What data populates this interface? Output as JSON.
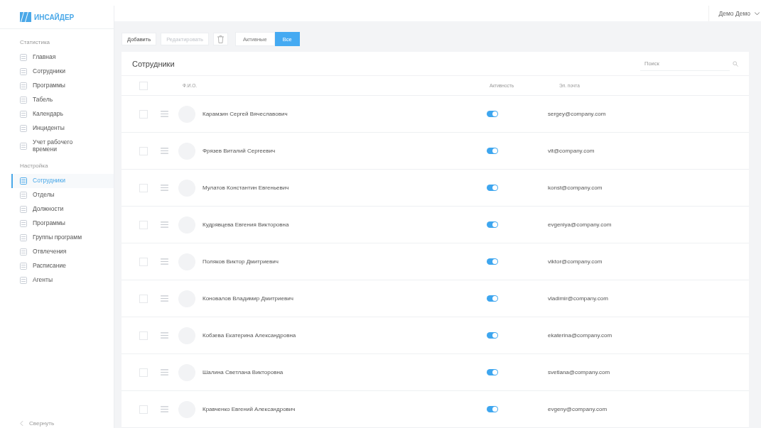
{
  "logo": {
    "text": "ИНСАЙДЕР"
  },
  "user": {
    "name": "Демо Демо"
  },
  "sidebar": {
    "sections": [
      {
        "title": "Статистика",
        "items": [
          {
            "label": "Главная",
            "selected": false
          },
          {
            "label": "Сотрудники",
            "selected": false
          },
          {
            "label": "Программы",
            "selected": false
          },
          {
            "label": "Табель",
            "selected": false
          },
          {
            "label": "Календарь",
            "selected": false
          },
          {
            "label": "Инциденты",
            "selected": false
          },
          {
            "label": "Учет рабочего времени",
            "selected": false
          }
        ]
      },
      {
        "title": "Настройка",
        "items": [
          {
            "label": "Сотрудники",
            "selected": true
          },
          {
            "label": "Отделы",
            "selected": false
          },
          {
            "label": "Должности",
            "selected": false
          },
          {
            "label": "Программы",
            "selected": false
          },
          {
            "label": "Группы программ",
            "selected": false
          },
          {
            "label": "Отвлечения",
            "selected": false
          },
          {
            "label": "Расписание",
            "selected": false
          },
          {
            "label": "Агенты",
            "selected": false
          }
        ]
      }
    ],
    "collapse": "Свернуть"
  },
  "toolbar": {
    "buttons": [
      {
        "label": "Добавить",
        "disabled": false
      },
      {
        "label": "Редактировать",
        "disabled": true
      }
    ],
    "filters": [
      {
        "label": "Активные",
        "selected": false
      },
      {
        "label": "Все",
        "selected": true
      }
    ]
  },
  "card": {
    "title": "Сотрудники",
    "search": {
      "placeholder": "Поиск"
    },
    "select_all": {
      "checked": false
    },
    "columns": [
      "Ф.И.О.",
      "Активность",
      "Эл. почта"
    ],
    "rows": [
      {
        "checked": false,
        "name": "Карамзин Сергей Вячеславович",
        "active": true,
        "email": "sergey@company.com"
      },
      {
        "checked": false,
        "name": "Фрязев Виталий Сергеевич",
        "active": true,
        "email": "vit@company.com"
      },
      {
        "checked": false,
        "name": "Мулатов Константин Евгеньевич",
        "active": true,
        "email": "konst@company.com"
      },
      {
        "checked": false,
        "name": "Кудрявцева Евгения Викторовна",
        "active": true,
        "email": "evgeniya@company.com"
      },
      {
        "checked": false,
        "name": "Поляков Виктор Дмитриевич",
        "active": true,
        "email": "viktor@company.com"
      },
      {
        "checked": false,
        "name": "Коновалов Владимир Дмитриевич",
        "active": true,
        "email": "vladimir@company.com"
      },
      {
        "checked": false,
        "name": "Кобзева Екатерина Александровна",
        "active": true,
        "email": "ekaterina@company.com"
      },
      {
        "checked": false,
        "name": "Шалина Светлана Викторовна",
        "active": true,
        "email": "svetlana@company.com"
      },
      {
        "checked": false,
        "name": "Кравченко Евгений Александрович",
        "active": true,
        "email": "evgeny@company.com"
      }
    ]
  }
}
